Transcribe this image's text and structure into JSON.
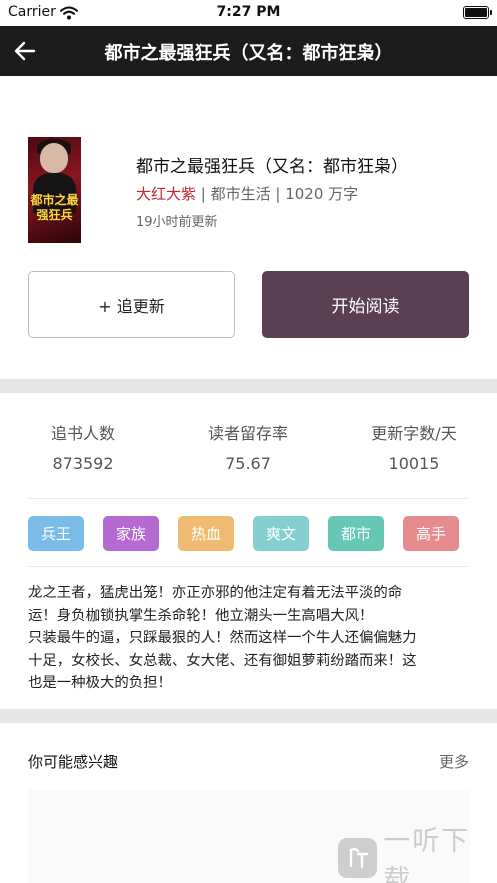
{
  "status_bar": {
    "carrier": "Carrier",
    "time": "7:27 PM"
  },
  "nav": {
    "title": "都市之最强狂兵（又名：都市狂枭）",
    "back_icon": "back-arrow-icon"
  },
  "book": {
    "cover_text": "都市之最强狂兵",
    "title": "都市之最强狂兵（又名：都市狂枭）",
    "author": "大红大紫",
    "separator": " | ",
    "category": "都市生活",
    "word_count": "1020 万字",
    "updated": "19小时前更新"
  },
  "actions": {
    "follow_label": "+ 追更新",
    "read_label": "开始阅读"
  },
  "stats": [
    {
      "label": "追书人数",
      "value": "873592"
    },
    {
      "label": "读者留存率",
      "value": "75.67"
    },
    {
      "label": "更新字数/天",
      "value": "10015"
    }
  ],
  "tags": [
    {
      "label": "兵王",
      "color": "#7bbbe8"
    },
    {
      "label": "家族",
      "color": "#b46ad0"
    },
    {
      "label": "热血",
      "color": "#f1ba72"
    },
    {
      "label": "爽文",
      "color": "#86cfd1"
    },
    {
      "label": "都市",
      "color": "#66c7b4"
    },
    {
      "label": "高手",
      "color": "#e88b8e"
    }
  ],
  "synopsis": {
    "lines": [
      "龙之王者，猛虎出笼！亦正亦邪的他注定有着无法平淡的命",
      "运！身负枷锁执掌生杀命轮！他立潮头一生高唱大风！",
      "只装最牛的逼，只踩最狠的人！然而这样一个牛人还偏偏魅力",
      "十足，女校长、女总裁、女大佬、还有御姐萝莉纷踏而来！这",
      "也是一种极大的负担！"
    ]
  },
  "recommend": {
    "title": "你可能感兴趣",
    "more_label": "更多"
  },
  "watermark": {
    "text": "一听下载"
  },
  "colors": {
    "nav_bg": "#1c1c1c",
    "read_button_bg": "#5b3f52",
    "author": "#c0282d",
    "divider": "#e6e6e6"
  }
}
